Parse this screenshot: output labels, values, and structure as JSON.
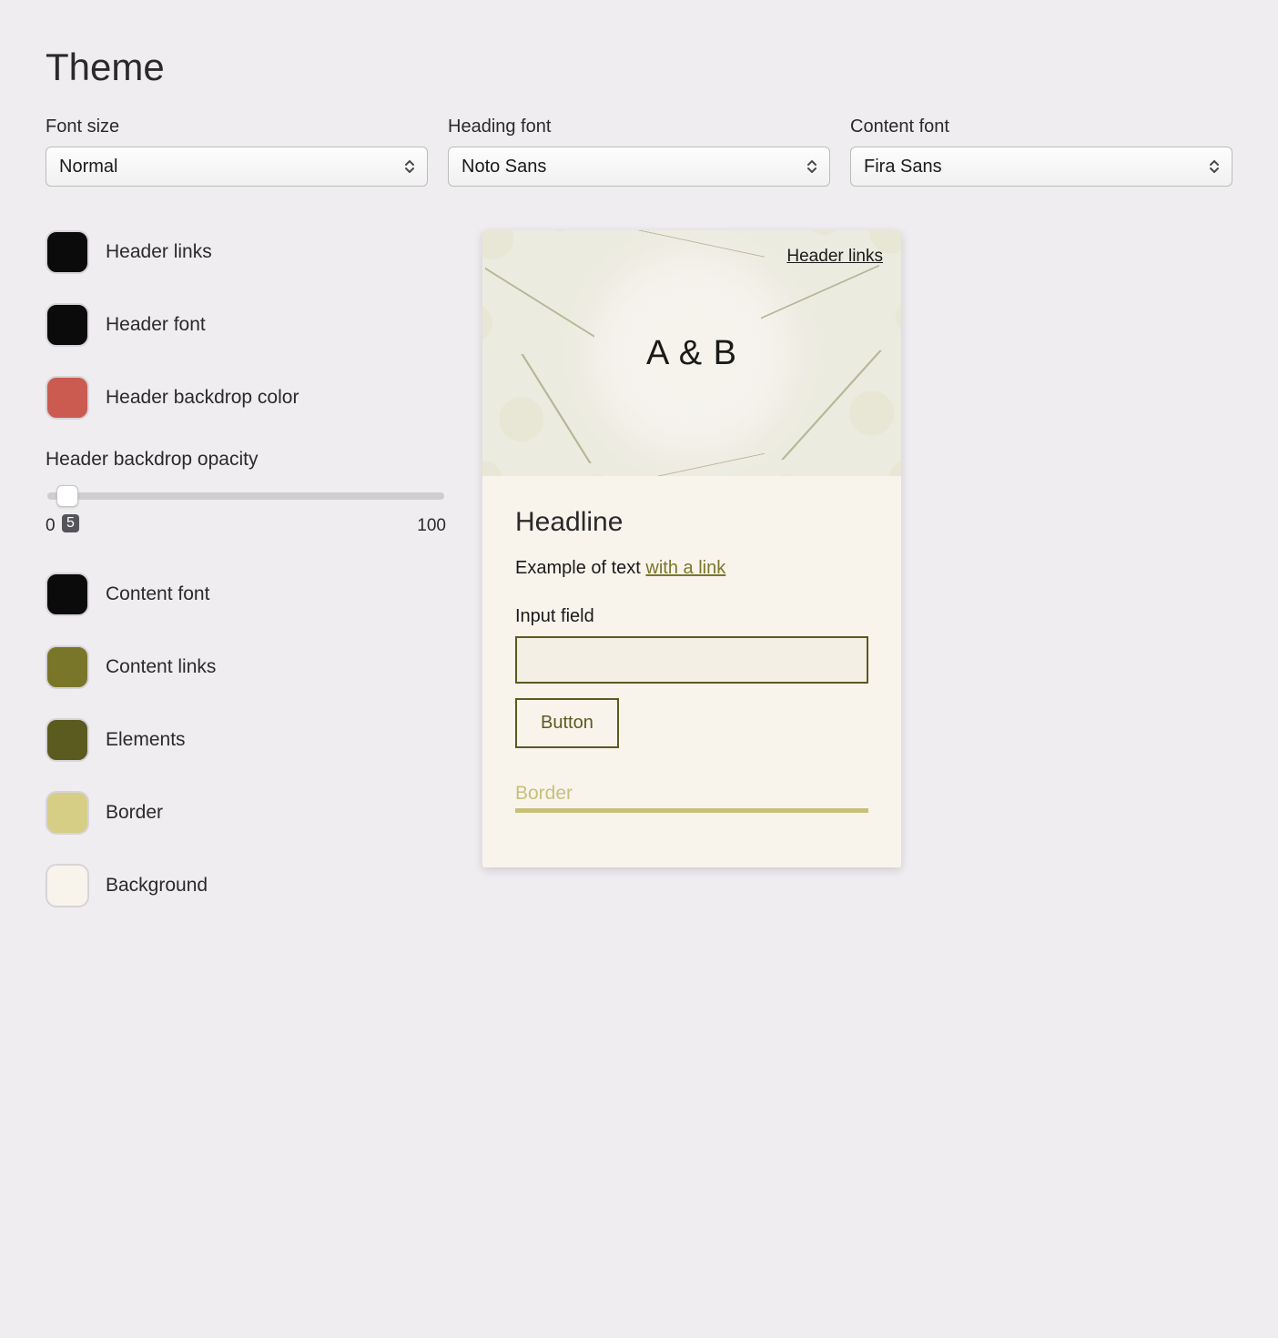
{
  "title": "Theme",
  "selects": {
    "font_size": {
      "label": "Font size",
      "value": "Normal"
    },
    "heading_font": {
      "label": "Heading font",
      "value": "Noto Sans"
    },
    "content_font": {
      "label": "Content font",
      "value": "Fira Sans"
    }
  },
  "colors": {
    "header_links": {
      "label": "Header links",
      "hex": "#0b0b0b"
    },
    "header_font": {
      "label": "Header font",
      "hex": "#0b0b0b"
    },
    "backdrop_color": {
      "label": "Header backdrop color",
      "hex": "#cb5a51"
    },
    "content_font": {
      "label": "Content font",
      "hex": "#0b0b0b"
    },
    "content_links": {
      "label": "Content links",
      "hex": "#7a7629"
    },
    "elements": {
      "label": "Elements",
      "hex": "#5b5a1f"
    },
    "border": {
      "label": "Border",
      "hex": "#d6ce85"
    },
    "background": {
      "label": "Background",
      "hex": "#f8f4ec"
    }
  },
  "slider": {
    "label": "Header backdrop opacity",
    "min": 0,
    "max": 100,
    "value": 5
  },
  "preview": {
    "header_link": "Header links",
    "title": "A & B",
    "headline": "Headline",
    "text_prefix": "Example of text ",
    "text_link": "with a link",
    "input_label": "Input field",
    "button_label": "Button",
    "border_label": "Border"
  }
}
